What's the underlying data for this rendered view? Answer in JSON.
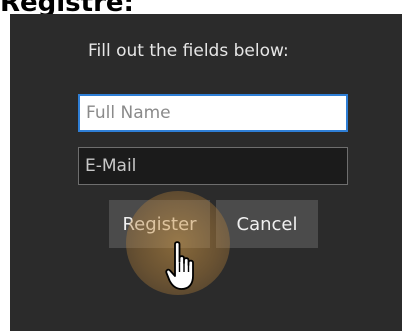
{
  "page": {
    "heading": "Registre:"
  },
  "dialog": {
    "instructions": "Fill out the fields below:",
    "fields": {
      "full_name": {
        "placeholder": "Full Name",
        "value": ""
      },
      "email": {
        "placeholder": "E-Mail",
        "value": ""
      }
    },
    "buttons": {
      "register_label": "Register",
      "cancel_label": "Cancel"
    }
  },
  "cursor": {
    "icon": "hand-pointer-icon"
  },
  "colors": {
    "dialog_background": "#2b2b2b",
    "button_background": "#4b4b4b",
    "focus_border": "#2f7fd6",
    "click_highlight": "#d49c48"
  }
}
